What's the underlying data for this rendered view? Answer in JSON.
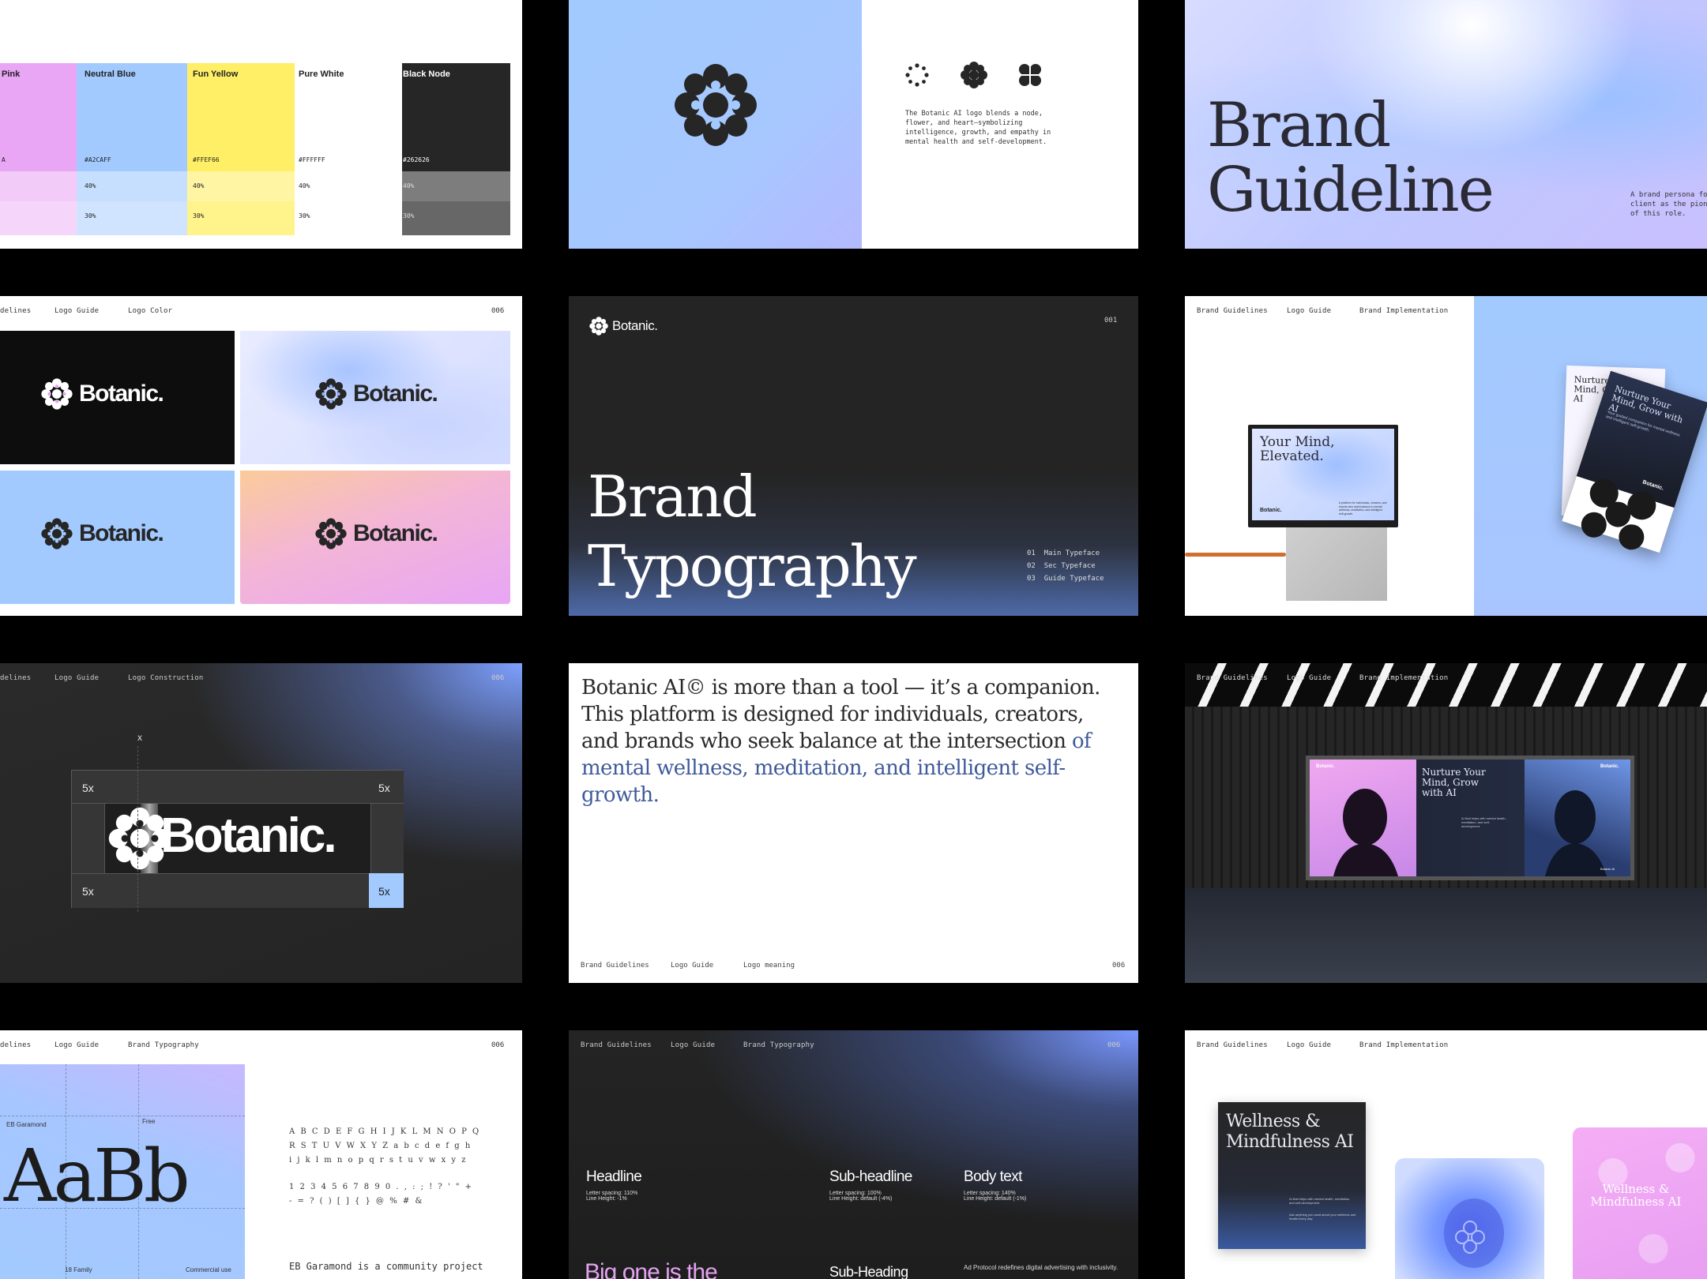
{
  "colors": {
    "pink": "#E8A6F5",
    "neutral_blue": "#A2CAFF",
    "fun_yellow": "#FFEF66",
    "pure_white": "#FFFFFF",
    "black_node": "#262626"
  },
  "palette": {
    "swatches": [
      {
        "name": "Pink",
        "hex": "A",
        "t40": "",
        "t30": ""
      },
      {
        "name": "Neutral Blue",
        "hex": "#A2CAFF",
        "t40": "40%",
        "t30": "30%"
      },
      {
        "name": "Fun Yellow",
        "hex": "#FFEF66",
        "t40": "40%",
        "t30": "30%"
      },
      {
        "name": "Pure White",
        "hex": "#FFFFFF",
        "t40": "40%",
        "t30": "30%"
      },
      {
        "name": "Black Node",
        "hex": "#262626",
        "t40": "40%",
        "t30": "30%"
      }
    ]
  },
  "logo_meaning": {
    "text": "The Botanic AI logo blends a node, flower, and heart—symbolizing intelligence, growth, and empathy in mental health and self-development."
  },
  "cover": {
    "title_line1": "Brand",
    "title_line2": "Guideline",
    "note": "A brand persona fo client as the pion of this role."
  },
  "logo_color": {
    "nav": [
      "delines",
      "Logo Guide",
      "Logo Color"
    ],
    "page": "006",
    "wordmark": "Botanic."
  },
  "typography_cover": {
    "wordmark": "Botanic.",
    "page": "001",
    "title_line1": "Brand",
    "title_line2": "Typography",
    "toc": [
      {
        "num": "01",
        "label": "Main Typeface"
      },
      {
        "num": "02",
        "label": "Sec Typeface"
      },
      {
        "num": "03",
        "label": "Guide Typeface"
      }
    ]
  },
  "implementation1": {
    "nav": [
      "Brand Guidelines",
      "Logo Guide",
      "Brand Implementation"
    ],
    "screen_headline": "Your Mind, Elevated.",
    "screen_brand": "Botanic.",
    "screen_copy": "A platform for individuals, creators, and brands who seek balance in mental wellness, meditation, and intelligent self-growth.",
    "card_headline": "Nurture Your Mind, Grow with AI",
    "card_brand": "Botanic.",
    "card_copy": "Your guided companion for mental wellness and intelligent self-growth."
  },
  "construction": {
    "nav": [
      "delines",
      "Logo Guide",
      "Logo Construction"
    ],
    "page": "006",
    "x_label": "x",
    "tags": [
      "5x",
      "5x",
      "5x",
      "5x"
    ],
    "wordmark": "Botanic."
  },
  "statement": {
    "text_plain": "Botanic AI© is more than a tool — it’s a companion. This platform is designed for individuals, creators, and brands who seek balance at the intersection ",
    "text_accent": "of mental wellness, meditation, and intelligent self-growth.",
    "nav": [
      "Brand Guidelines",
      "Logo Guide",
      "Logo meaning"
    ],
    "page": "006"
  },
  "billboard": {
    "nav": [
      "Brand Guidelines",
      "Logo Guide",
      "Brand Implementation"
    ],
    "headline": "Nurture Your Mind, Grow with AI",
    "brand": "Botanic.",
    "copy": "AI that helps with mental health, meditation, and self-development.",
    "small": "Botanic.AI"
  },
  "typeface": {
    "nav": [
      "delines",
      "Logo Guide",
      "Brand Typography"
    ],
    "page": "006",
    "label_name": "EB Garamond",
    "label_free": "Free",
    "label_family": "18 Family",
    "label_use": "Commercial use",
    "specimen": "AaBb",
    "glyphs": [
      "A B C D E F G H I J K L M N O P Q",
      "R S T U V W X Y Z a b c d e f g h",
      "i j k l m n o p q r s t u v w x y z",
      "1 2 3 4 5 6 7 8 9 0 . , : ; ! ? ' \" +",
      "- = ? ( ) [ ] { } @ % # &"
    ],
    "body": "EB Garamond is a community project"
  },
  "type_scale": {
    "nav": [
      "Brand Guidelines",
      "Logo Guide",
      "Brand Typography"
    ],
    "page": "006",
    "items": [
      {
        "name": "Headline",
        "spec1": "Letter spacing: 110%",
        "spec2": "Line Height: -1%"
      },
      {
        "name": "Sub-headline",
        "spec1": "Letter spacing: 100%",
        "spec2": "Line Height: default (-4%)"
      },
      {
        "name": "Body text",
        "spec1": "Letter spacing: 140%",
        "spec2": "Line Height: default (-1%)"
      }
    ],
    "sample_big": "Big one is the",
    "sample_sub": "Sub-Heading",
    "sample_body": "Ad Protocol redefines digital advertising with inclusivity."
  },
  "implementation2": {
    "nav": [
      "Brand Guidelines",
      "Logo Guide",
      "Brand Implementation"
    ],
    "card_title": "Wellness & Mindfulness AI",
    "card_item1": "AI that helps with mental health, meditation, and self-development.",
    "card_item2": "Ask anything you want about your wellness and health every day.",
    "pink_title": "Wellness & Mindfulness AI"
  }
}
